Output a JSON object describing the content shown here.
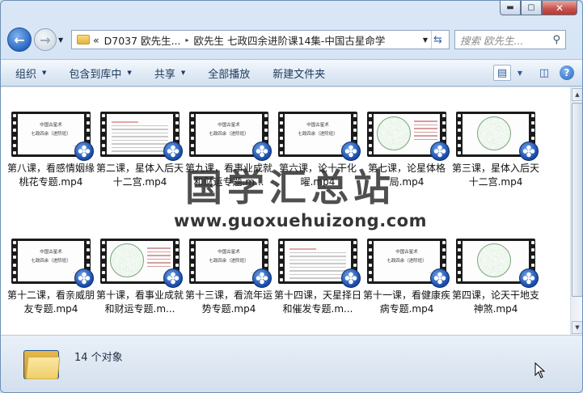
{
  "window": {
    "caption": {
      "minimize": "▬",
      "maximize": "▢",
      "close": "✕"
    }
  },
  "nav": {
    "address": {
      "crumb_prefix": "«",
      "crumbs": [
        "D7037 欧先生...",
        "欧先生 七政四余进阶课14集-中国古星命学"
      ],
      "separator": "▸"
    },
    "search_placeholder": "搜索 欧先生...",
    "search_icon": "magnifier-icon"
  },
  "toolbar": {
    "items": [
      "组织",
      "包含到库中",
      "共享",
      "全部播放",
      "新建文件夹"
    ],
    "dropdown_items": [
      true,
      true,
      true,
      false,
      false
    ]
  },
  "files": [
    {
      "name": "第八课，看感情姻缘桃花专题.mp4",
      "thumb": "title"
    },
    {
      "name": "第二课，星体入后天十二宫.mp4",
      "thumb": "text"
    },
    {
      "name": "第九课，看事业成就和财运专题.m...",
      "thumb": "title"
    },
    {
      "name": "第六课，论十干化曜.mp4",
      "thumb": "title"
    },
    {
      "name": "第七课，论星体格局.mp4",
      "thumb": "chart"
    },
    {
      "name": "第三课，星体入后天十二宫.mp4",
      "thumb": "chart-full"
    },
    {
      "name": "第十二课，看亲威朋友专题.mp4",
      "thumb": "title"
    },
    {
      "name": "第十课，看事业成就和财运专题.m...",
      "thumb": "chart"
    },
    {
      "name": "第十三课，看流年运势专题.mp4",
      "thumb": "title"
    },
    {
      "name": "第十四课，天星择日和催发专题.m...",
      "thumb": "text"
    },
    {
      "name": "第十一课，看健康疾病专题.mp4",
      "thumb": "title"
    },
    {
      "name": "第四课，论天干地支神煞.mp4",
      "thumb": "chart-full"
    }
  ],
  "slide_title": {
    "line1": "中国古星术",
    "line2": "七政四余（进阶班）"
  },
  "watermark": {
    "cn": "国学汇总站",
    "url": "www.guoxuehuizong.com"
  },
  "status": {
    "count_text": "14 个对象"
  }
}
